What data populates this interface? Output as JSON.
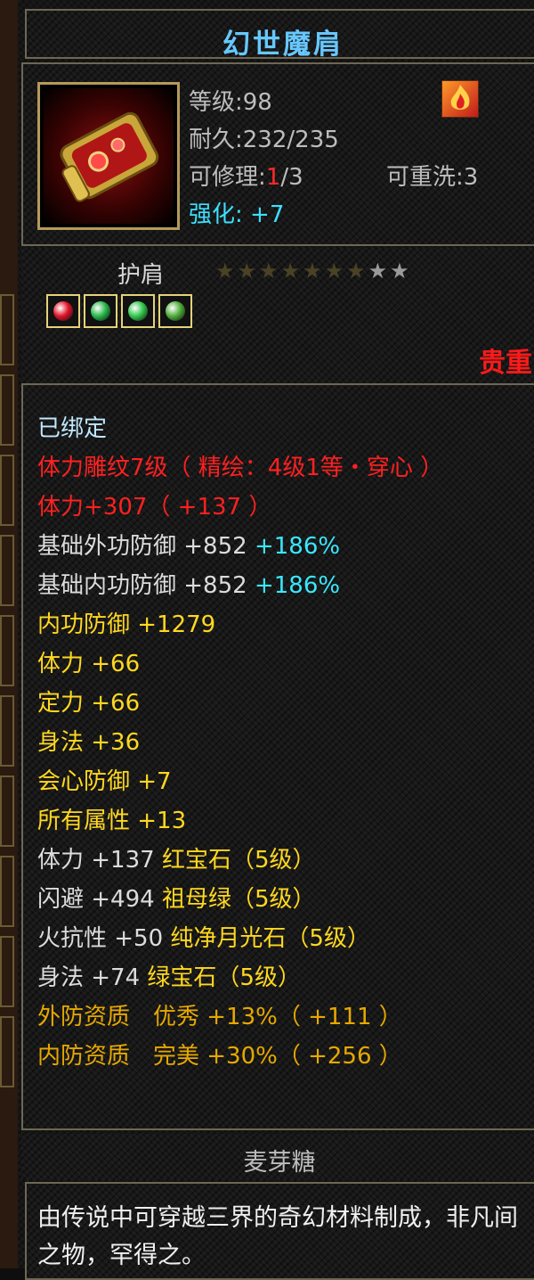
{
  "item": {
    "name": "幻世魔肩",
    "level_line": "等级:98",
    "durability_line": "耐久:232/235",
    "repair_label": "可修理:",
    "repair_current": "1",
    "repair_total": "/3",
    "rewash_line": "可重洗:3",
    "enhance_label": "强化:",
    "enhance_value": "+7",
    "type": "护肩",
    "rarity": "贵重",
    "stars_total": 9,
    "stars_lit": 7
  },
  "gems": [
    {
      "name": "ruby-gem-icon",
      "color": "#e0142a"
    },
    {
      "name": "emerald-gem-icon",
      "color": "#28b84a"
    },
    {
      "name": "emerald-gem-icon",
      "color": "#32c84e"
    },
    {
      "name": "emerald-gem-icon",
      "color": "#4fae3a"
    }
  ],
  "attributes": {
    "bound": "已绑定",
    "engrave": "体力雕纹7级（ 精绘：4级1等・穿心 ）",
    "stamina_main": "体力+307（ +137 ）",
    "outer_def_base": "基础外功防御 +852",
    "outer_def_pct": "+186%",
    "inner_def_base": "基础内功防御 +852",
    "inner_def_pct": "+186%",
    "inner_def": "内功防御 +1279",
    "stamina": "体力 +66",
    "focus": "定力 +66",
    "agility": "身法 +36",
    "crit_def": "会心防御 +7",
    "all_attr": "所有属性 +13",
    "gem1_stat": "体力 +137",
    "gem1_name": "红宝石（5级）",
    "gem2_stat": "闪避 +494",
    "gem2_name": "祖母绿（5级）",
    "gem3_stat": "火抗性 +50",
    "gem3_name": "纯净月光石（5级）",
    "gem4_stat": "身法 +74",
    "gem4_name": "绿宝石（5级）",
    "outer_qual": "外防资质　优秀 +13%（ +111 ）",
    "inner_qual": "内防资质　完美 +30%（ +256 ）"
  },
  "material": {
    "name": "麦芽糖",
    "description": "由传说中可穿越三界的奇幻材料制成，非凡间之物，罕得之。"
  }
}
